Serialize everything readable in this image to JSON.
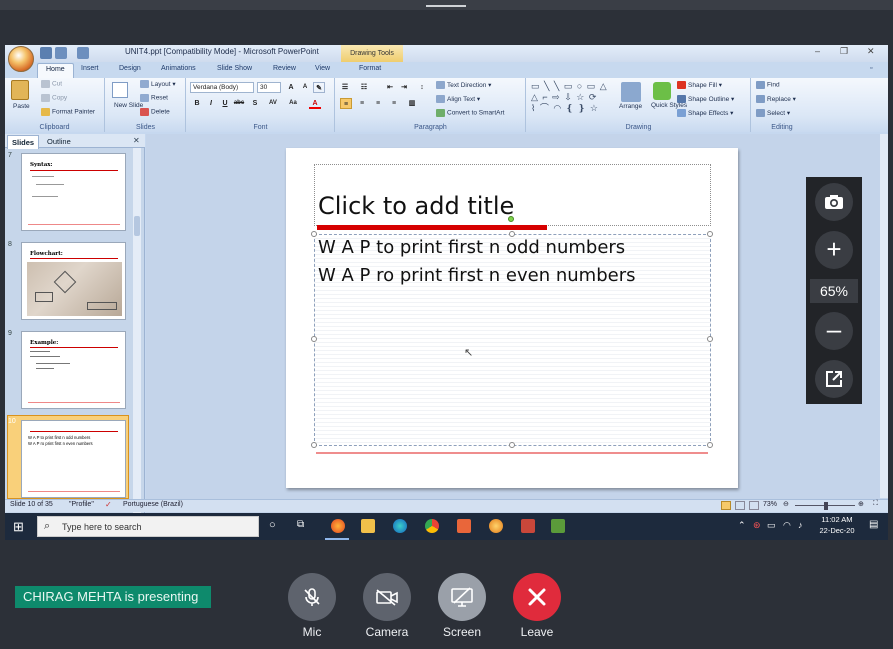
{
  "window": {
    "title": "UNIT4.ppt [Compatibility Mode] - Microsoft PowerPoint",
    "drawing_tools": "Drawing Tools",
    "tabs": [
      "Home",
      "Insert",
      "Design",
      "Animations",
      "Slide Show",
      "Review",
      "View",
      "Format"
    ]
  },
  "ribbon": {
    "clipboard": {
      "paste": "Paste",
      "cut": "Cut",
      "copy": "Copy",
      "format_painter": "Format Painter",
      "label": "Clipboard"
    },
    "slides": {
      "new_slide": "New Slide",
      "layout": "Layout",
      "reset": "Reset",
      "delete": "Delete",
      "label": "Slides"
    },
    "font": {
      "name": "Verdana (Body)",
      "size": "30",
      "label": "Font"
    },
    "paragraph": {
      "text_direction": "Text Direction",
      "align_text": "Align Text",
      "smartart": "Convert to SmartArt",
      "label": "Paragraph"
    },
    "drawing": {
      "arrange": "Arrange",
      "quick_styles": "Quick Styles",
      "shape_fill": "Shape Fill",
      "shape_outline": "Shape Outline",
      "shape_effects": "Shape Effects",
      "label": "Drawing"
    },
    "editing": {
      "find": "Find",
      "replace": "Replace",
      "select": "Select",
      "label": "Editing"
    }
  },
  "panel": {
    "tabs": [
      "Slides",
      "Outline"
    ],
    "thumbnails": [
      {
        "num": "7",
        "title": "Syntax:"
      },
      {
        "num": "8",
        "title": "Flowchart:"
      },
      {
        "num": "9",
        "title": "Example:"
      },
      {
        "num": "10",
        "title": "",
        "lines": [
          "W A P to print first n odd numbers",
          "W A P ro print first n even numbers"
        ]
      }
    ]
  },
  "slide": {
    "title_placeholder": "Click to add title",
    "lines": [
      "W A P to print first n odd numbers",
      "W A P ro print first n even numbers"
    ]
  },
  "status": {
    "slide_count": "Slide 10 of 35",
    "theme": "\"Profile\"",
    "language": "Portuguese (Brazil)",
    "zoom": "73%"
  },
  "taskbar": {
    "search_placeholder": "Type here to search",
    "time": "11:02 AM",
    "date": "22-Dec-20"
  },
  "viewer": {
    "zoom": "65%"
  },
  "meeting": {
    "presenter_banner": "CHIRAG MEHTA is presenting",
    "controls": [
      "Mic",
      "Camera",
      "Screen",
      "Leave"
    ]
  },
  "colors": {
    "accent_red": "#e02b3c",
    "presenter_green": "#0e8a6c",
    "title_bar": "#cc0000"
  }
}
